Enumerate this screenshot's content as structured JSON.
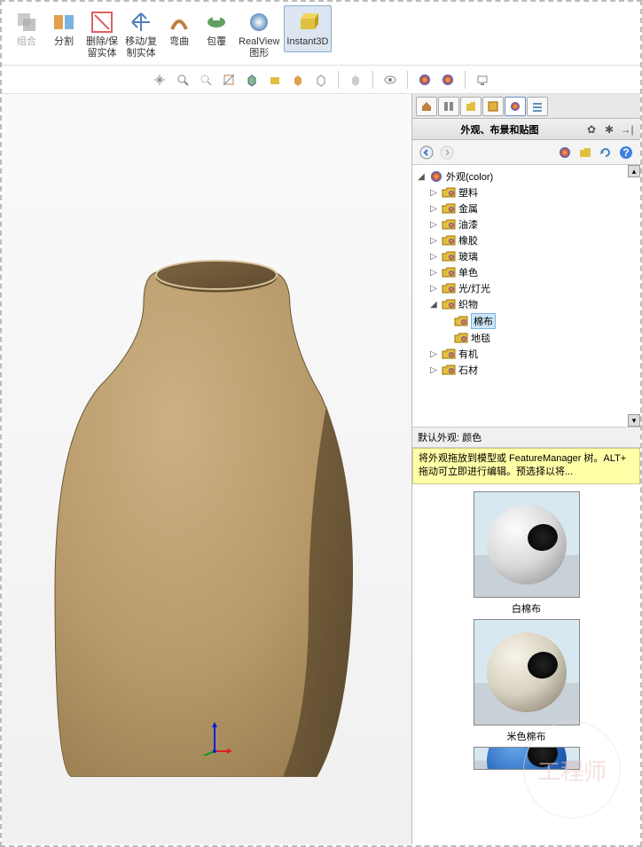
{
  "toolbar": [
    {
      "id": "combine",
      "label": "组合",
      "disabled": true
    },
    {
      "id": "split",
      "label": "分割"
    },
    {
      "id": "delete-keep",
      "label": "删除/保\n留实体"
    },
    {
      "id": "move-copy",
      "label": "移动/复\n制实体"
    },
    {
      "id": "bend",
      "label": "弯曲"
    },
    {
      "id": "wrap",
      "label": "包覆"
    },
    {
      "id": "realview",
      "label": "RealView\n图形"
    },
    {
      "id": "instant3d",
      "label": "Instant3D",
      "pressed": true
    }
  ],
  "panel": {
    "title": "外观、布景和贴图",
    "hint_title": "默认外观: 颜色",
    "hint_body": "将外观拖放到模型或 FeatureManager 树。ALT+ 拖动可立即进行编辑。预选择以将...",
    "tree_root": "外观(color)",
    "categories": [
      {
        "label": "塑料"
      },
      {
        "label": "金属"
      },
      {
        "label": "油漆"
      },
      {
        "label": "橡胶"
      },
      {
        "label": "玻璃"
      },
      {
        "label": "单色"
      },
      {
        "label": "光/灯光"
      },
      {
        "label": "织物",
        "expanded": true,
        "children": [
          {
            "label": "棉布",
            "selected": true
          },
          {
            "label": "地毯"
          }
        ]
      },
      {
        "label": "有机"
      },
      {
        "label": "石材"
      }
    ],
    "previews": [
      {
        "label": "白棉布",
        "hi": "#fdfdfd",
        "base": "#d8d8d8",
        "shadow": "#888"
      },
      {
        "label": "米色棉布",
        "hi": "#f8f4ea",
        "base": "#d6d0be",
        "shadow": "#7a7260"
      }
    ]
  },
  "watermark": "工程师"
}
